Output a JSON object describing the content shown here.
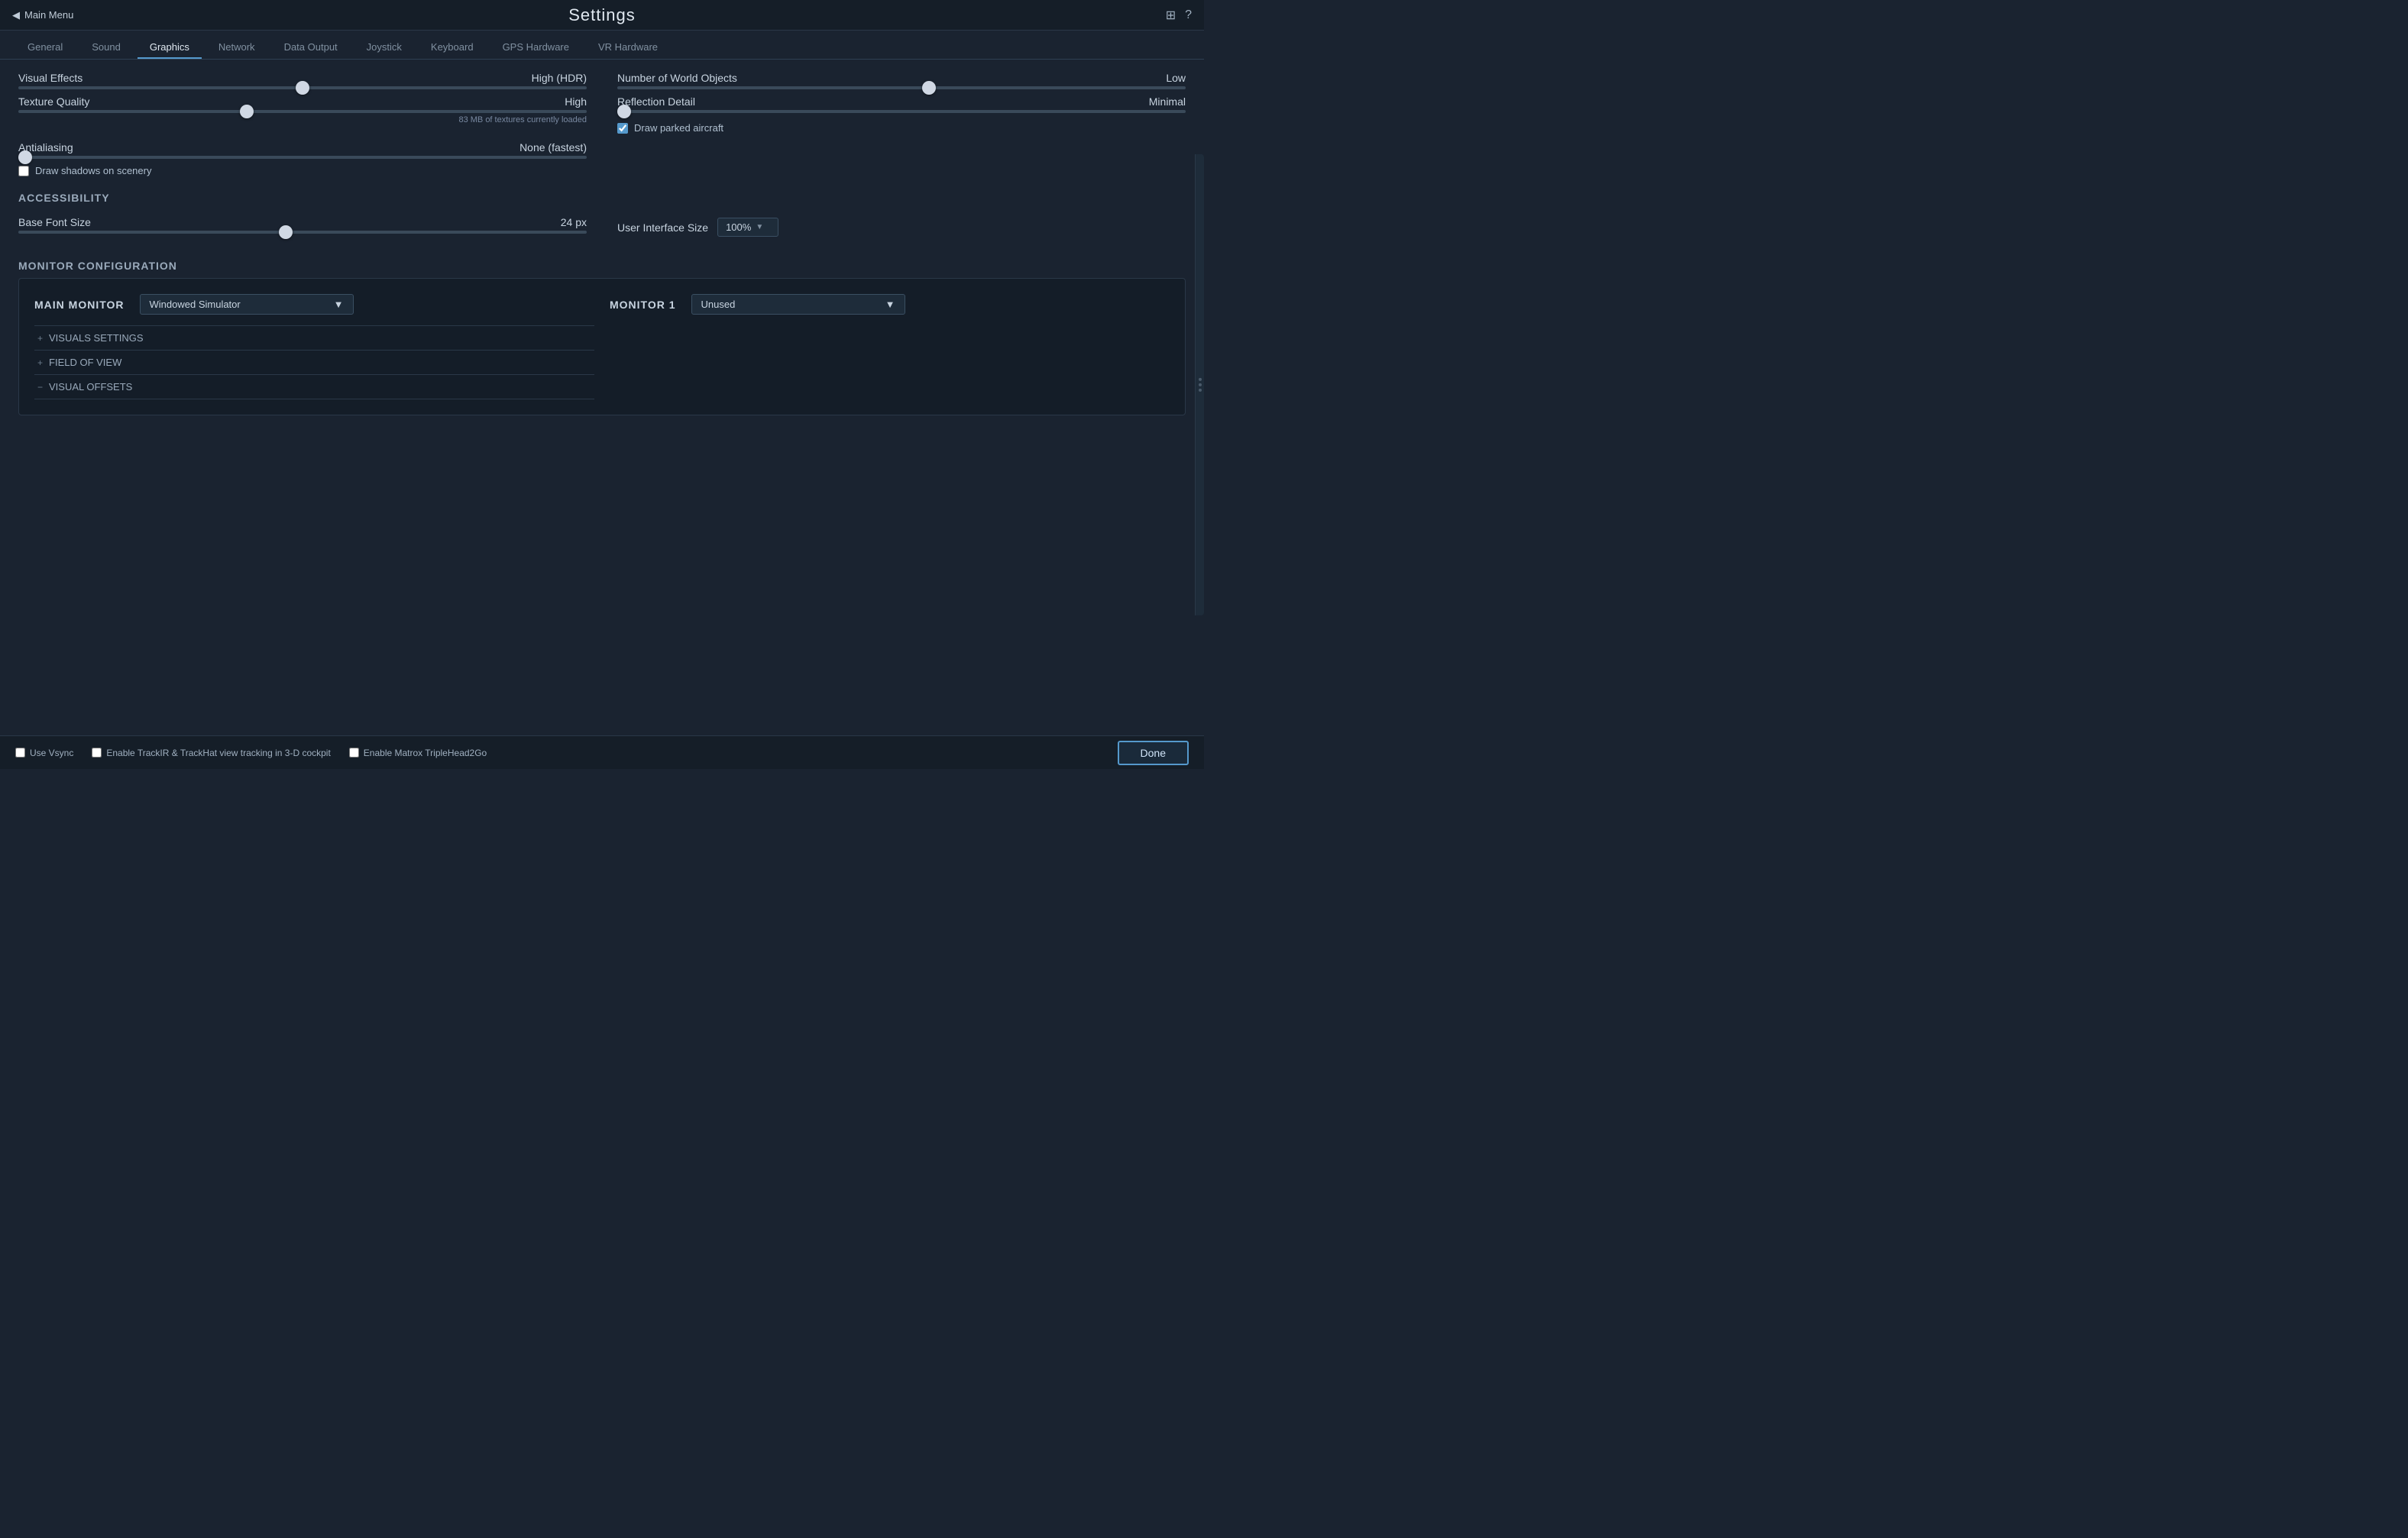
{
  "topbar": {
    "back_label": "Main Menu",
    "title": "Settings",
    "icons": [
      "sliders-icon",
      "question-icon"
    ]
  },
  "tabs": [
    {
      "label": "General",
      "active": false
    },
    {
      "label": "Sound",
      "active": false
    },
    {
      "label": "Graphics",
      "active": true
    },
    {
      "label": "Network",
      "active": false
    },
    {
      "label": "Data Output",
      "active": false
    },
    {
      "label": "Joystick",
      "active": false
    },
    {
      "label": "Keyboard",
      "active": false
    },
    {
      "label": "GPS Hardware",
      "active": false
    },
    {
      "label": "VR Hardware",
      "active": false
    }
  ],
  "graphics": {
    "visual_effects": {
      "label": "Visual Effects",
      "value": "High (HDR)",
      "pct": 50
    },
    "texture_quality": {
      "label": "Texture Quality",
      "value": "High",
      "pct": 40,
      "sub": "83 MB of textures currently loaded"
    },
    "antialiasing": {
      "label": "Antialiasing",
      "value": "None (fastest)",
      "pct": 0
    },
    "draw_shadows": {
      "label": "Draw shadows on scenery",
      "checked": false
    },
    "num_world_objects": {
      "label": "Number of World Objects",
      "value": "Low",
      "pct": 55
    },
    "reflection_detail": {
      "label": "Reflection Detail",
      "value": "Minimal",
      "pct": 0
    },
    "draw_parked": {
      "label": "Draw parked aircraft",
      "checked": true
    }
  },
  "accessibility": {
    "title": "ACCESSIBILITY",
    "base_font_size": {
      "label": "Base Font Size",
      "value": "24 px",
      "pct": 47
    },
    "ui_size": {
      "label": "User Interface Size",
      "value": "100%"
    }
  },
  "monitor_config": {
    "title": "MONITOR CONFIGURATION",
    "main_monitor": {
      "title": "MAIN MONITOR",
      "dropdown_value": "Windowed Simulator"
    },
    "monitor1": {
      "title": "MONITOR 1",
      "dropdown_value": "Unused"
    },
    "items": [
      {
        "icon": "+",
        "label": "VISUALS SETTINGS"
      },
      {
        "icon": "+",
        "label": "FIELD OF VIEW"
      },
      {
        "icon": "−",
        "label": "VISUAL OFFSETS"
      }
    ]
  },
  "bottom": {
    "use_vsync": {
      "label": "Use Vsync",
      "checked": false
    },
    "trackir": {
      "label": "Enable TrackIR & TrackHat view tracking in 3-D cockpit",
      "checked": false
    },
    "matrox": {
      "label": "Enable Matrox TripleHead2Go",
      "checked": false
    },
    "done_label": "Done"
  }
}
